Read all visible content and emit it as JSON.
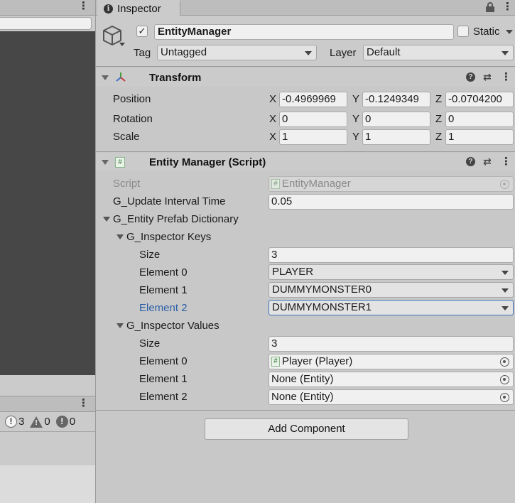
{
  "left_panel": {
    "console": {
      "info_count": "3",
      "warning_count": "0",
      "error_count": "0"
    }
  },
  "inspector": {
    "tab_label": "Inspector",
    "object": {
      "name": "EntityManager",
      "active": true,
      "static_label": "Static",
      "tag_label": "Tag",
      "tag_value": "Untagged",
      "layer_label": "Layer",
      "layer_value": "Default"
    },
    "transform": {
      "title": "Transform",
      "rows": [
        {
          "label": "Position",
          "x": "-0.4969969",
          "y": "-0.1249349",
          "z": "-0.0704200"
        },
        {
          "label": "Rotation",
          "x": "0",
          "y": "0",
          "z": "0"
        },
        {
          "label": "Scale",
          "x": "1",
          "y": "1",
          "z": "1"
        }
      ],
      "axis_x": "X",
      "axis_y": "Y",
      "axis_z": "Z"
    },
    "script_component": {
      "title": "Entity Manager (Script)",
      "script_label": "Script",
      "script_value": "EntityManager",
      "update_label": "G_Update Interval Time",
      "update_value": "0.05",
      "dictionary_label": "G_Entity Prefab Dictionary",
      "keys": {
        "label": "G_Inspector Keys",
        "size_label": "Size",
        "size_value": "3",
        "elements": [
          {
            "label": "Element 0",
            "value": "PLAYER"
          },
          {
            "label": "Element 1",
            "value": "DUMMYMONSTER0"
          },
          {
            "label": "Element 2",
            "value": "DUMMYMONSTER1"
          }
        ]
      },
      "values": {
        "label": "G_Inspector Values",
        "size_label": "Size",
        "size_value": "3",
        "elements": [
          {
            "label": "Element 0",
            "value": "Player (Player)"
          },
          {
            "label": "Element 1",
            "value": "None (Entity)"
          },
          {
            "label": "Element 2",
            "value": "None (Entity)"
          }
        ]
      }
    },
    "add_component_label": "Add Component",
    "colors": {
      "focus_blue": "#2a5fa8",
      "panel_bg": "#c8c8c8",
      "scene_bg": "#474747"
    }
  }
}
